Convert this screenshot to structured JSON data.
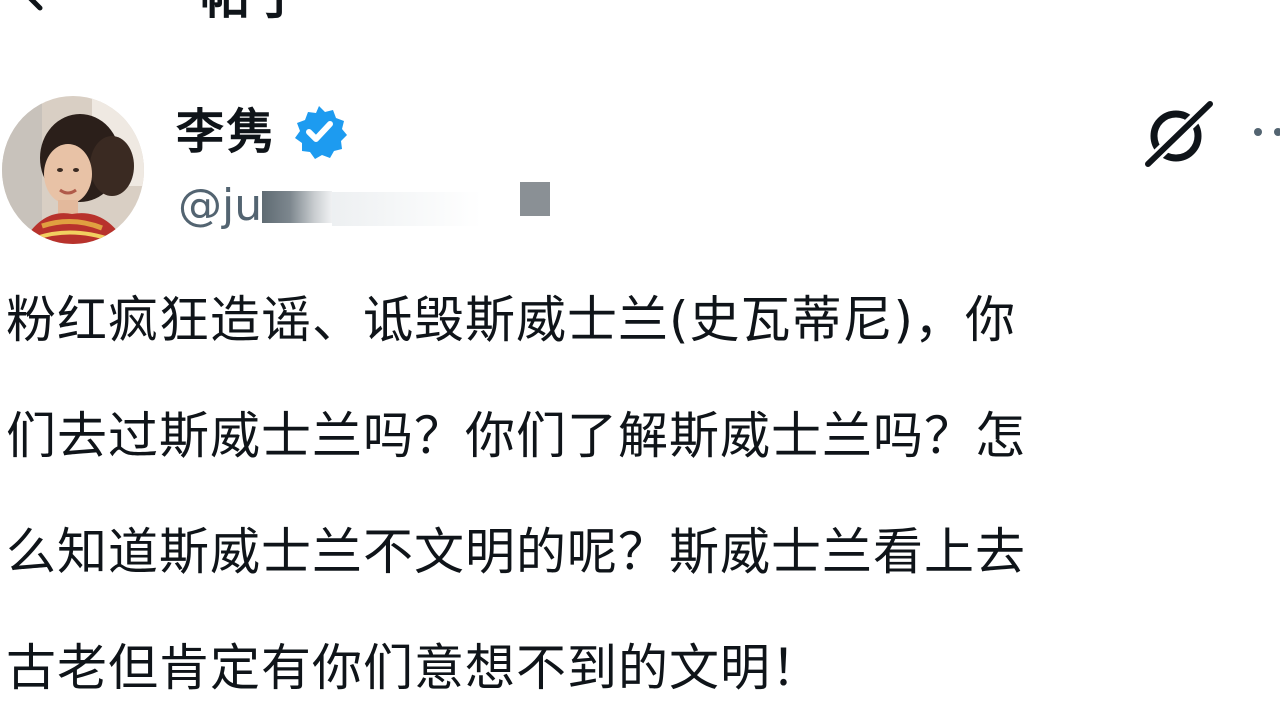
{
  "header": {
    "title": "帖子",
    "back_icon": "arrow-left-icon"
  },
  "author": {
    "display_name": "李隽",
    "handle": "@ju",
    "verified_icon": "verified-badge-icon",
    "verified_color": "#1d9bf0",
    "avatar_icon": "user-avatar"
  },
  "actions": {
    "grok_icon": "grok-icon",
    "more_icon": "more-options-icon"
  },
  "post": {
    "lines": [
      "粉红疯狂造谣、诋毁斯威士兰(史瓦蒂尼)，你",
      "们去过斯威士兰吗？你们了解斯威士兰吗？怎",
      "么知道斯威士兰不文明的呢？斯威士兰看上去",
      "古老但肯定有你们意想不到的文明！"
    ]
  }
}
